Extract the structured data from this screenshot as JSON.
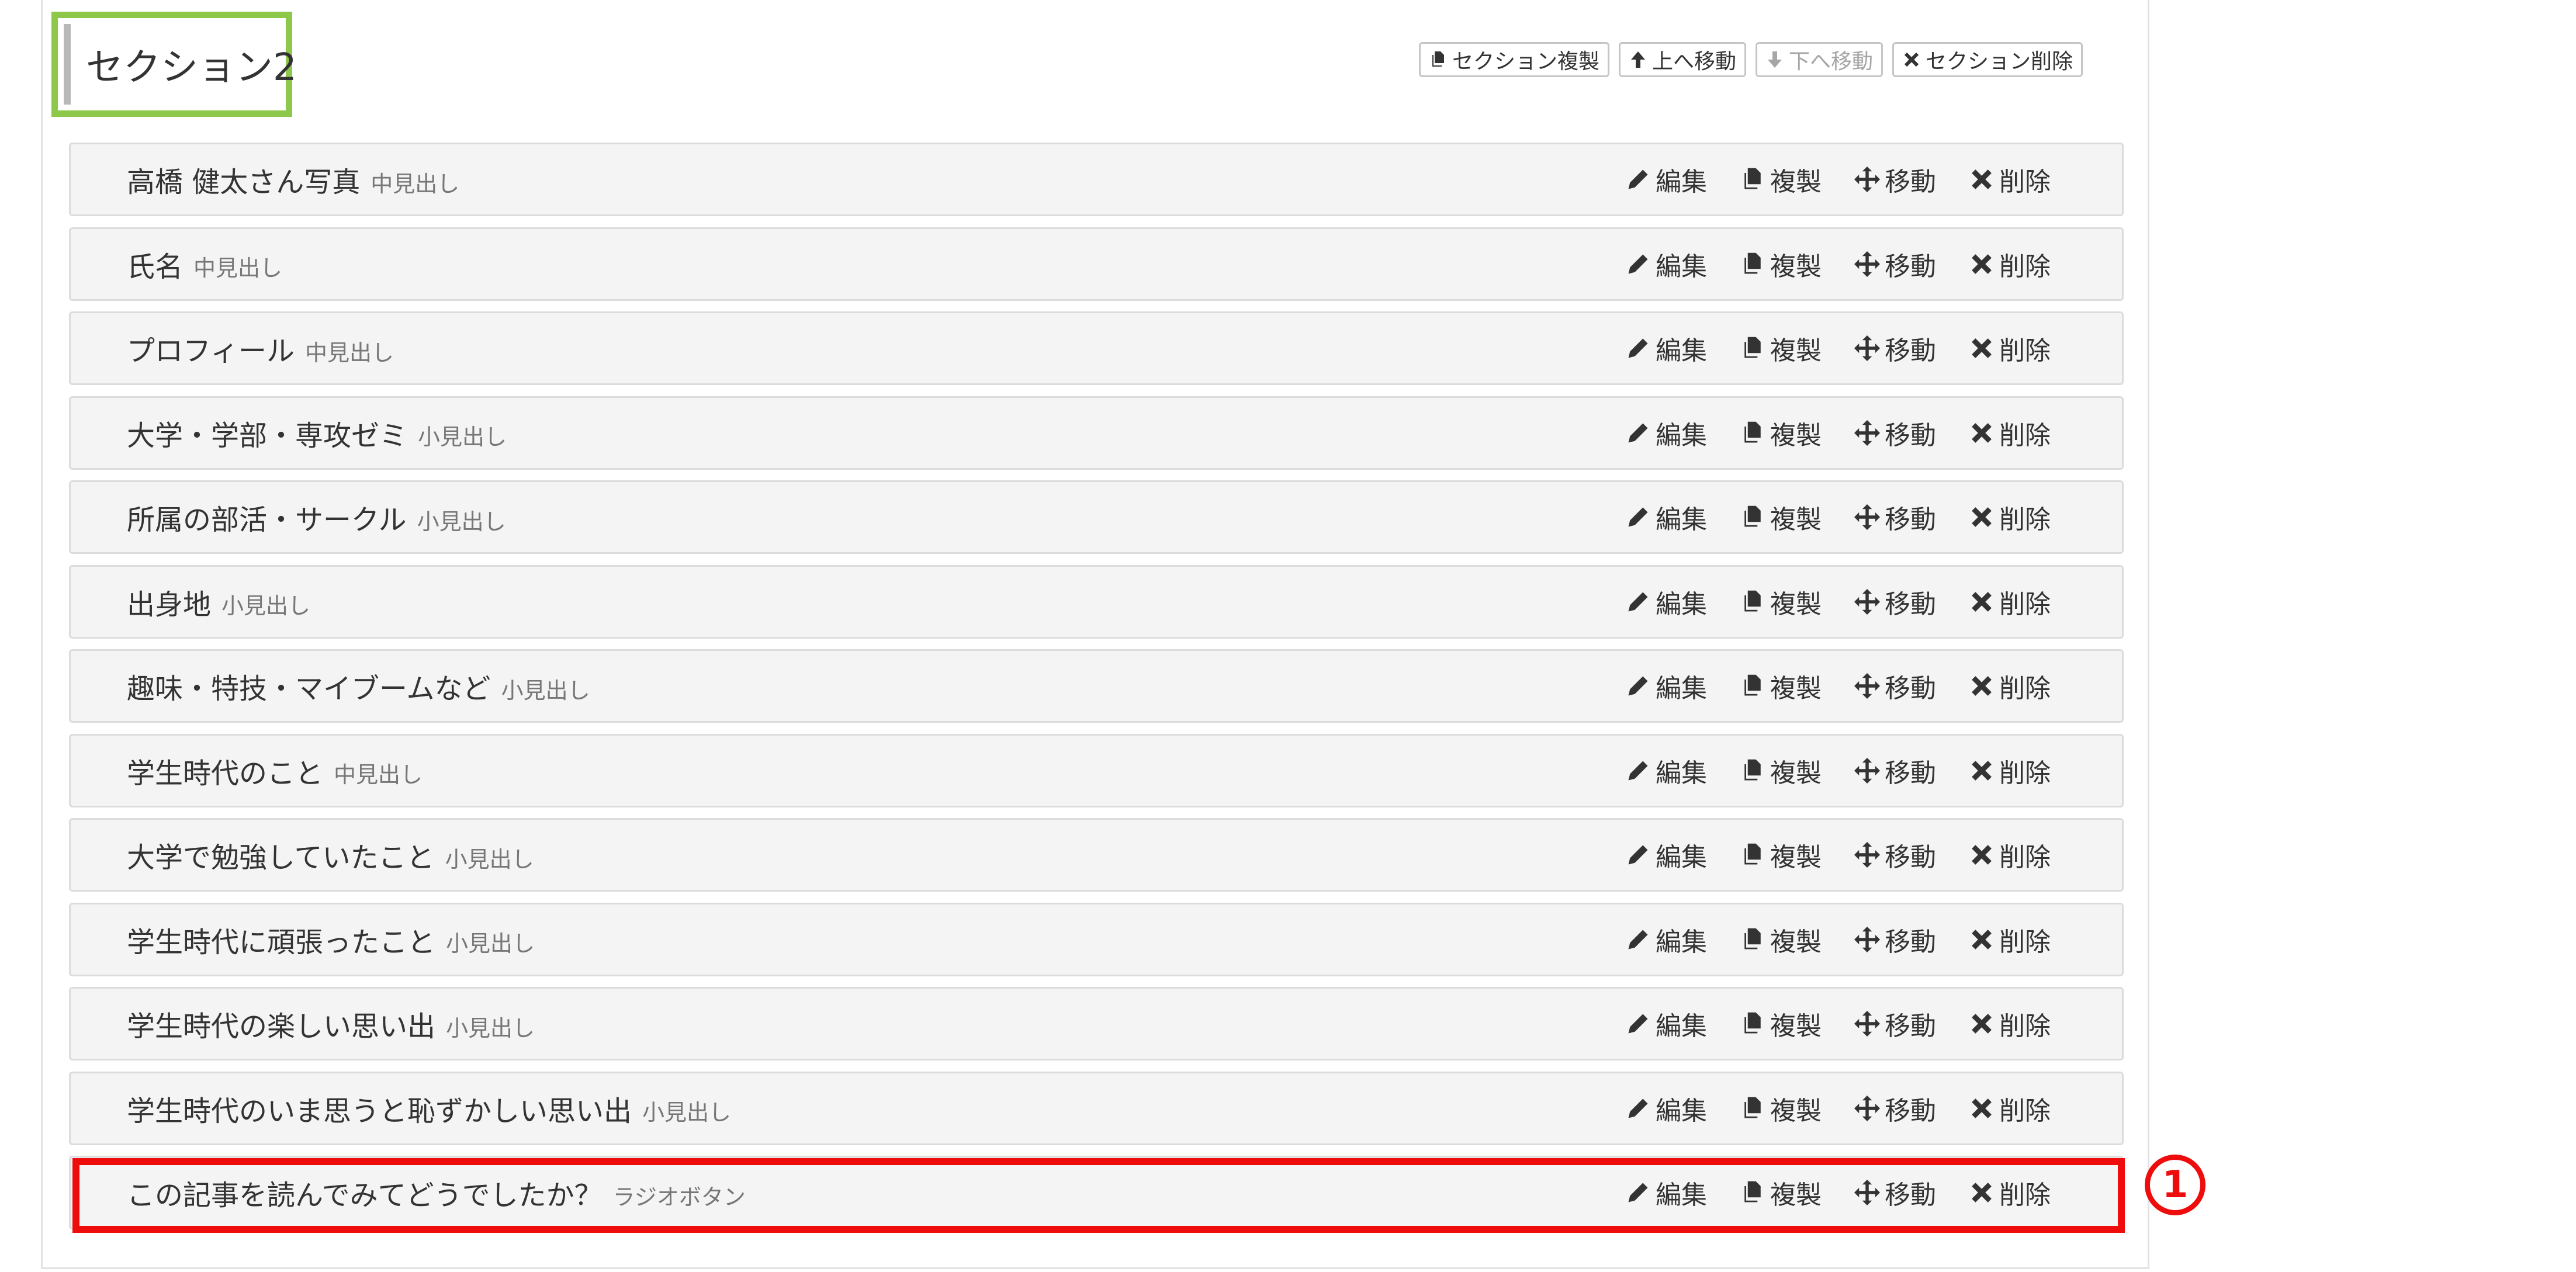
{
  "section": {
    "title": "セクション2",
    "toolbar": {
      "copy_label": "セクション複製",
      "up_label": "上へ移動",
      "down_label": "下へ移動",
      "delete_label": "セクション削除"
    }
  },
  "row_actions": {
    "edit": "編集",
    "copy": "複製",
    "move": "移動",
    "delete": "削除"
  },
  "rows": [
    {
      "name": "高橋 健太さん写真",
      "kind": "中見出し"
    },
    {
      "name": "氏名",
      "kind": "中見出し"
    },
    {
      "name": "プロフィール",
      "kind": "中見出し"
    },
    {
      "name": "大学・学部・専攻ゼミ",
      "kind": "小見出し"
    },
    {
      "name": "所属の部活・サークル",
      "kind": "小見出し"
    },
    {
      "name": "出身地",
      "kind": "小見出し"
    },
    {
      "name": "趣味・特技・マイブームなど",
      "kind": "小見出し"
    },
    {
      "name": "学生時代のこと",
      "kind": "中見出し"
    },
    {
      "name": "大学で勉強していたこと",
      "kind": "小見出し"
    },
    {
      "name": "学生時代に頑張ったこと",
      "kind": "小見出し"
    },
    {
      "name": "学生時代の楽しい思い出",
      "kind": "小見出し"
    },
    {
      "name": "学生時代のいま思うと恥ずかしい思い出",
      "kind": "小見出し"
    },
    {
      "name": "この記事を読んでみてどうでしたか？",
      "kind": "ラジオボタン"
    }
  ],
  "annotation": {
    "marker": "1",
    "highlight_color": "#ee0c0c",
    "section_highlight_color": "#8dc84a"
  }
}
